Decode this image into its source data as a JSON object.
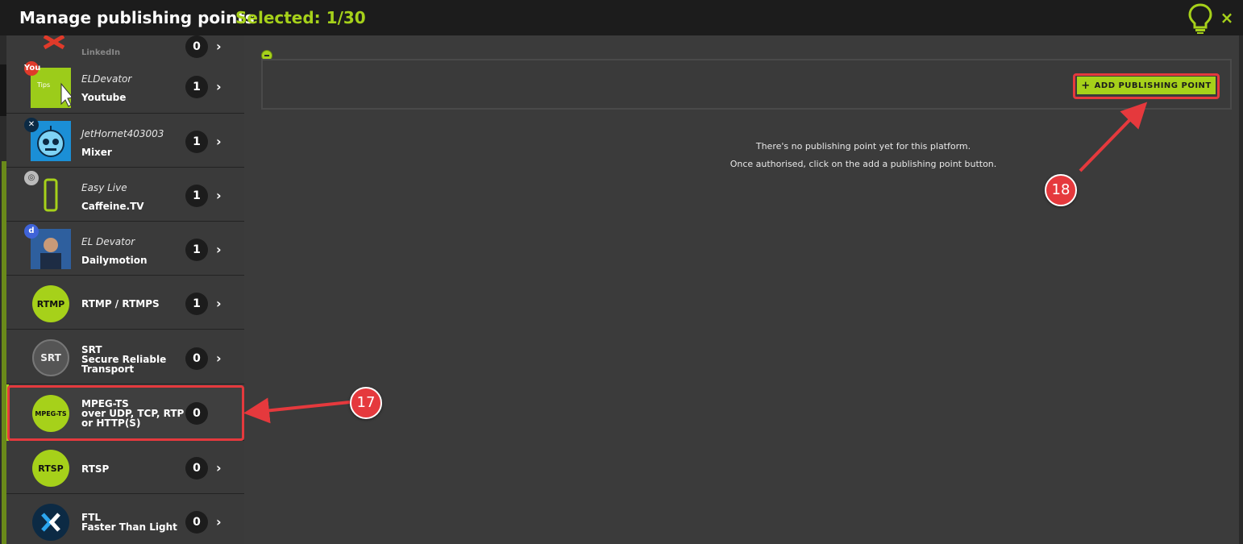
{
  "header": {
    "title": "Manage publishing points",
    "selected_text": "Selected: 1/30",
    "help_icon": "lightbulb-icon",
    "close_label": "×"
  },
  "sidebar": {
    "items": [
      {
        "name": "LinkedIn",
        "account": "",
        "platform": "",
        "count": "0",
        "icon": "linkedin-icon"
      },
      {
        "name": "Youtube",
        "account": "ELDevator",
        "platform": "Youtube",
        "count": "1",
        "icon": "youtube-icon",
        "badge": "You"
      },
      {
        "name": "Mixer",
        "account": "JetHornet403003",
        "platform": "Mixer",
        "count": "1",
        "icon": "mixer-icon"
      },
      {
        "name": "Caffeine",
        "account": "Easy Live",
        "platform": "Caffeine.TV",
        "count": "1",
        "icon": "caffeine-icon"
      },
      {
        "name": "Dailymotion",
        "account": "EL Devator",
        "platform": "Dailymotion",
        "count": "1",
        "icon": "dailymotion-icon",
        "badge": "d"
      },
      {
        "name": "RTMP",
        "logo_text": "RTMP",
        "platform": "RTMP / RTMPS",
        "count": "1"
      },
      {
        "name": "SRT",
        "logo_text": "SRT",
        "line1": "SRT",
        "line2": "Secure Reliable",
        "line3": "Transport",
        "count": "0"
      },
      {
        "name": "MPEG-TS",
        "logo_text": "MPEG-TS",
        "line1": "MPEG-TS",
        "line2": "over UDP, TCP, RTP",
        "line3": "or HTTP(S)",
        "count": "0"
      },
      {
        "name": "RTSP",
        "logo_text": "RTSP",
        "platform": "RTSP",
        "count": "0"
      },
      {
        "name": "FTL",
        "line1": "FTL",
        "line2": "Faster Than Light",
        "count": "0"
      }
    ],
    "chevron": "›"
  },
  "main": {
    "add_button_label": "ADD PUBLISHING POINT",
    "add_button_plus": "+",
    "message_line1": "There's no publishing point yet for this platform.",
    "message_line2": "Once authorised, click on the add a publishing point button."
  },
  "annotations": {
    "callout_17": "17",
    "callout_18": "18"
  },
  "colors": {
    "accent": "#a6d11a",
    "annotation_red": "#e5393d",
    "titlebar": "#1c1c1c",
    "panel": "#3b3b3b"
  }
}
